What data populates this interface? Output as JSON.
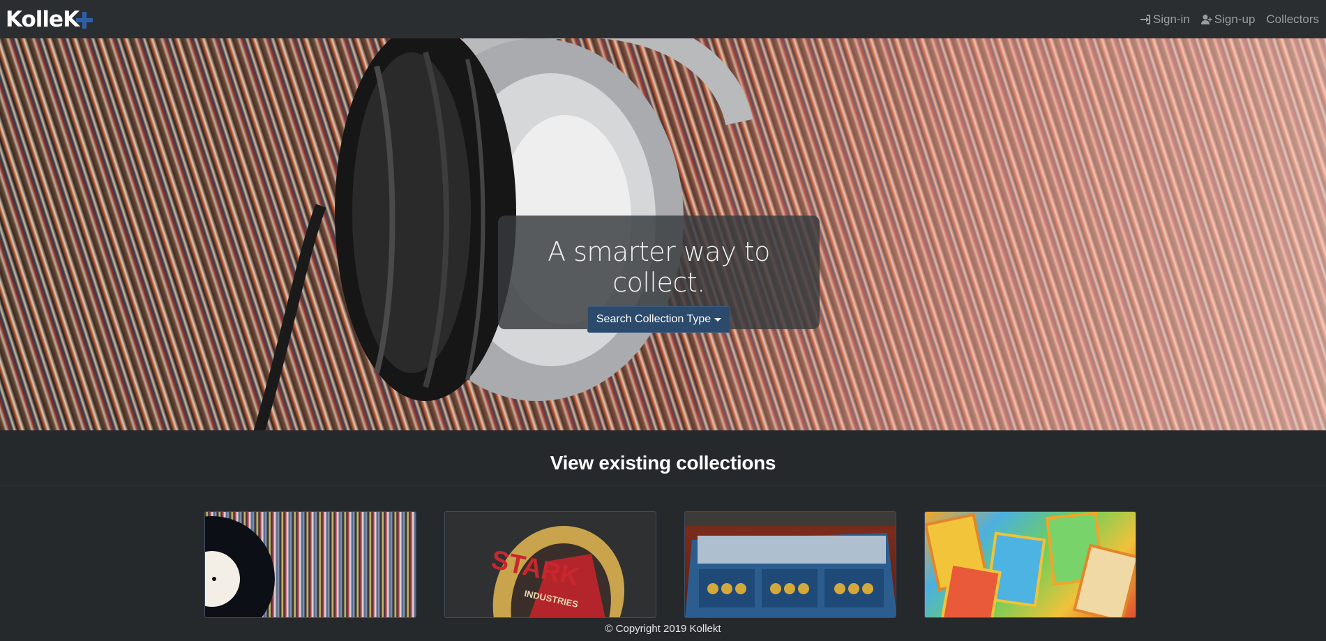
{
  "navbar": {
    "brand": "Kolle",
    "brand_tail": "K",
    "links": [
      {
        "label": "Sign-in",
        "icon": "sign-in-icon"
      },
      {
        "label": "Sign-up",
        "icon": "user-plus-icon"
      },
      {
        "label": "Collectors",
        "icon": ""
      }
    ]
  },
  "hero": {
    "title": "A smarter way to collect.",
    "button_label": "Search Collection Type"
  },
  "collections": {
    "title": "View existing collections",
    "cards": [
      {
        "name": "vinyl-records"
      },
      {
        "name": "stark-industries"
      },
      {
        "name": "coins"
      },
      {
        "name": "pokemon-cards"
      }
    ]
  },
  "footer": {
    "text": "© Copyright 2019 Kollekt"
  },
  "colors": {
    "navbar_bg": "#2b2e31",
    "page_bg": "#26292c",
    "brand_accent": "#2f5fa8",
    "button_bg": "#2c4a6b",
    "nav_link": "#9a9da1"
  }
}
